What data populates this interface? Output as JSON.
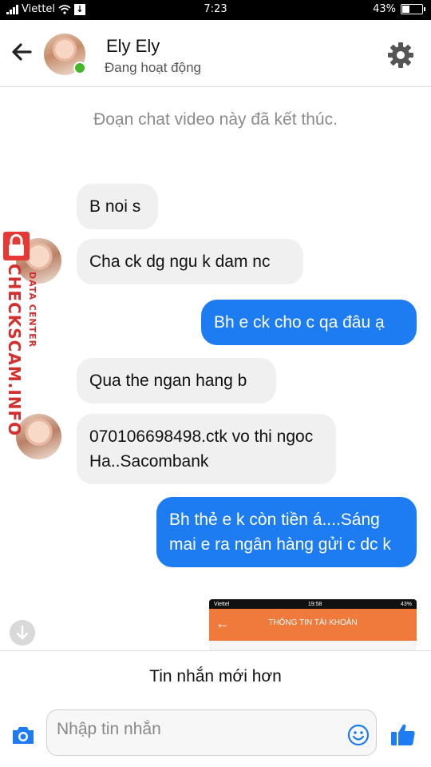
{
  "status_bar": {
    "carrier": "Viettel",
    "time": "7:23",
    "battery": "43%",
    "battery_level": 0.43
  },
  "header": {
    "name": "Ely Ely",
    "presence": "Đang hoạt động"
  },
  "chat": {
    "system_message": "Đoạn chat video này đã kết thúc.",
    "messages": [
      {
        "from": "them",
        "text": "B noi s"
      },
      {
        "from": "them",
        "text": "Cha ck dg ngu k dam nc"
      },
      {
        "from": "me",
        "text": "Bh e ck cho c qa đâu ạ"
      },
      {
        "from": "them",
        "text": "Qua the ngan hang b"
      },
      {
        "from": "them",
        "text": "070106698498.ctk vo thi ngoc Ha..Sacombank"
      },
      {
        "from": "me",
        "text": "Bh thẻ e k còn tiền á....Sáng mai e ra ngân hàng gửi c dc k"
      }
    ],
    "image_preview": {
      "status_carrier": "Viettel",
      "status_time": "19:58",
      "status_battery": "43%",
      "title": "THÔNG TIN TÀI KHOẢN"
    }
  },
  "watermark": {
    "text": "CHECKSCAM.INFO",
    "subtext": "DATA CENTER"
  },
  "newer_messages": "Tin nhắn mới hơn",
  "composer": {
    "placeholder": "Nhập tin nhắn"
  },
  "colors": {
    "accent": "#1e7cf2",
    "online": "#42b72a",
    "incoming_bubble": "#f0f0f0"
  },
  "icons": [
    "back-arrow-icon",
    "gear-icon",
    "camera-icon",
    "emoji-icon",
    "like-icon",
    "scroll-down-icon"
  ]
}
